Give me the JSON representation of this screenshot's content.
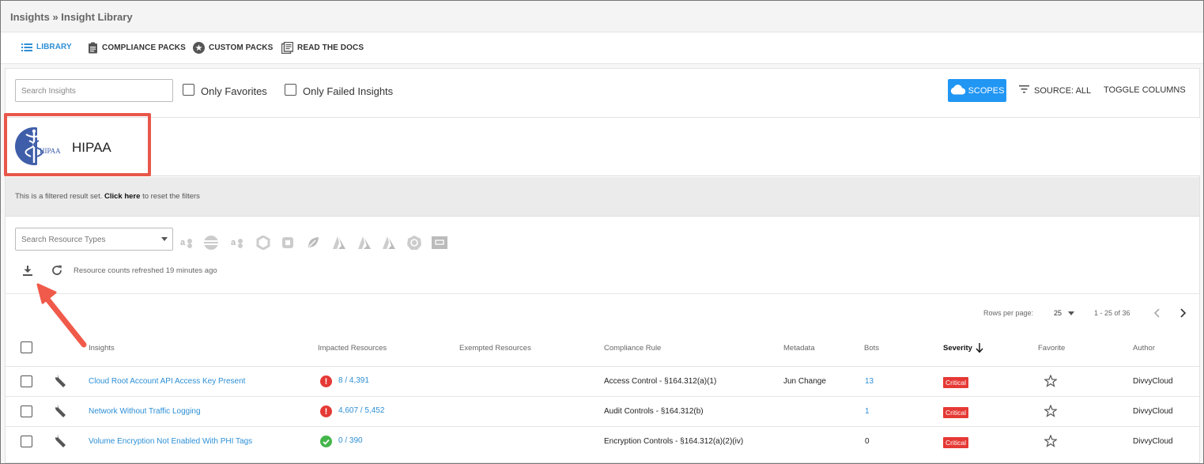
{
  "breadcrumb": "Insights » Insight Library",
  "nav": {
    "library": "LIBRARY",
    "compliance_packs": "COMPLIANCE PACKS",
    "custom_packs": "CUSTOM PACKS",
    "read_docs": "READ THE DOCS"
  },
  "toolbar": {
    "search_placeholder": "Search Insights",
    "only_favorites": "Only Favorites",
    "only_failed": "Only Failed Insights",
    "scopes": "SCOPES",
    "source": "SOURCE: ALL",
    "toggle_columns": "TOGGLE COLUMNS"
  },
  "pack": {
    "title": "HIPAA",
    "logo_text": "HIPAA"
  },
  "filter_notice": {
    "prefix": "This is a filtered result set.",
    "link": "Click here",
    "suffix": "to reset the filters"
  },
  "resource_filter": {
    "placeholder": "Search Resource Types"
  },
  "refresh_text": "Resource counts refreshed 19 minutes ago",
  "pagination": {
    "rows_per_page_label": "Rows per page:",
    "rows_per_page": "25",
    "range": "1 - 25 of 36"
  },
  "columns": {
    "insights": "Insights",
    "impacted": "Impacted Resources",
    "exempted": "Exempted Resources",
    "compliance": "Compliance Rule",
    "metadata": "Metadata",
    "bots": "Bots",
    "severity": "Severity",
    "favorite": "Favorite",
    "author": "Author"
  },
  "rows": [
    {
      "name": "Cloud Root Account API Access Key Present",
      "status": "fail",
      "impacted": "8 / 4,391",
      "compliance": "Access Control - §164.312(a)(1)",
      "metadata": "Jun Change",
      "bots": "13",
      "severity": "Critical",
      "author": "DivvyCloud"
    },
    {
      "name": "Network Without Traffic Logging",
      "status": "fail",
      "impacted": "4,607 / 5,452",
      "compliance": "Audit Controls - §164.312(b)",
      "metadata": "",
      "bots": "1",
      "severity": "Critical",
      "author": "DivvyCloud"
    },
    {
      "name": "Volume Encryption Not Enabled With PHI Tags",
      "status": "pass",
      "impacted": "0 / 390",
      "compliance": "Encryption Controls - §164.312(a)(2)(iv)",
      "metadata": "",
      "bots": "0",
      "severity": "Critical",
      "author": "DivvyCloud"
    }
  ],
  "colors": {
    "accent": "#2d8fd5",
    "critical": "#e53935",
    "highlight": "#e8574a",
    "pass": "#43b649"
  }
}
